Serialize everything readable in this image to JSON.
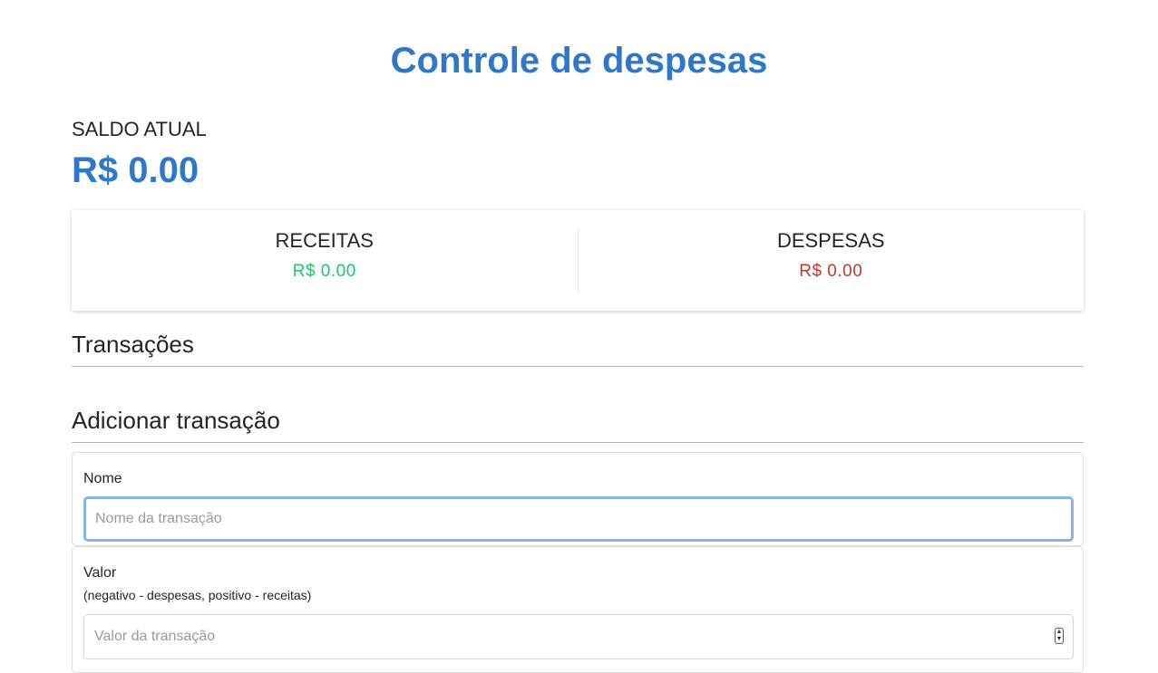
{
  "header": {
    "title": "Controle de despesas"
  },
  "balance": {
    "label": "SALDO ATUAL",
    "value": "R$ 0.00"
  },
  "summary": {
    "income": {
      "label": "RECEITAS",
      "value": "R$ 0.00",
      "color": "#1fc46f"
    },
    "expense": {
      "label": "DESPESAS",
      "value": "R$ 0.00",
      "color": "#c0392b"
    }
  },
  "transactions": {
    "title": "Transações",
    "items": []
  },
  "add_form": {
    "title": "Adicionar transação",
    "name_field": {
      "label": "Nome",
      "placeholder": "Nome da transação",
      "value": ""
    },
    "amount_field": {
      "label": "Valor",
      "hint": "(negativo - despesas, positivo - receitas)",
      "placeholder": "Valor da transação",
      "value": ""
    }
  },
  "colors": {
    "accent": "#2f78c9",
    "focus_ring": "#86b3ea"
  }
}
